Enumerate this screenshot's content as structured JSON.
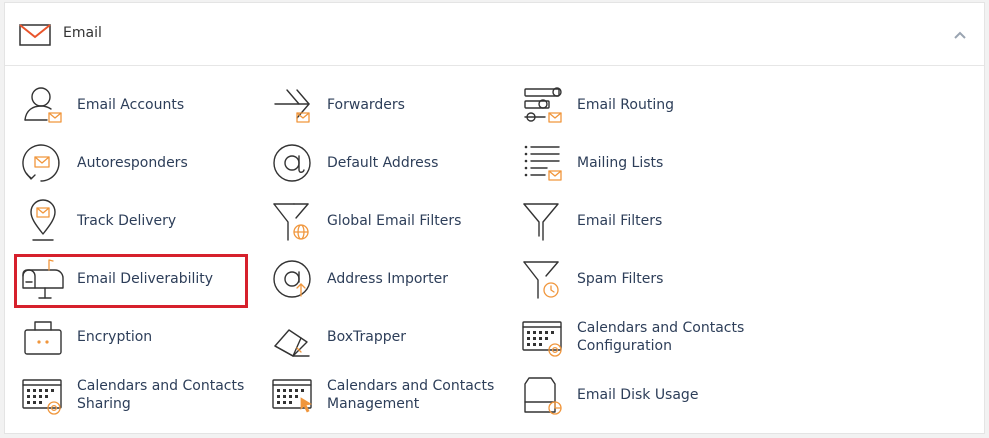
{
  "section": {
    "title": "Email",
    "accent_color": "#f0963c",
    "highlight_color": "#d6202c"
  },
  "items": [
    {
      "label": "Email Accounts",
      "icon": "user-mail-icon"
    },
    {
      "label": "Forwarders",
      "icon": "forward-arrow-icon"
    },
    {
      "label": "Email Routing",
      "icon": "routing-icon"
    },
    {
      "label": "Autoresponders",
      "icon": "autoresponder-icon"
    },
    {
      "label": "Default Address",
      "icon": "at-sign-icon"
    },
    {
      "label": "Mailing Lists",
      "icon": "list-mail-icon"
    },
    {
      "label": "Track Delivery",
      "icon": "location-pin-mail-icon"
    },
    {
      "label": "Global Email Filters",
      "icon": "funnel-globe-icon"
    },
    {
      "label": "Email Filters",
      "icon": "funnel-icon"
    },
    {
      "label": "Email Deliverability",
      "icon": "mailbox-icon"
    },
    {
      "label": "Address Importer",
      "icon": "at-import-icon"
    },
    {
      "label": "Spam Filters",
      "icon": "funnel-clock-icon"
    },
    {
      "label": "Encryption",
      "icon": "lock-box-icon"
    },
    {
      "label": "BoxTrapper",
      "icon": "box-trap-icon"
    },
    {
      "label": "Calendars and Contacts Configuration",
      "icon": "calendar-gear-at-icon"
    },
    {
      "label": "Calendars and Contacts Sharing",
      "icon": "calendar-share-icon"
    },
    {
      "label": "Calendars and Contacts Management",
      "icon": "calendar-cursor-icon"
    },
    {
      "label": "Email Disk Usage",
      "icon": "disk-usage-icon"
    }
  ]
}
